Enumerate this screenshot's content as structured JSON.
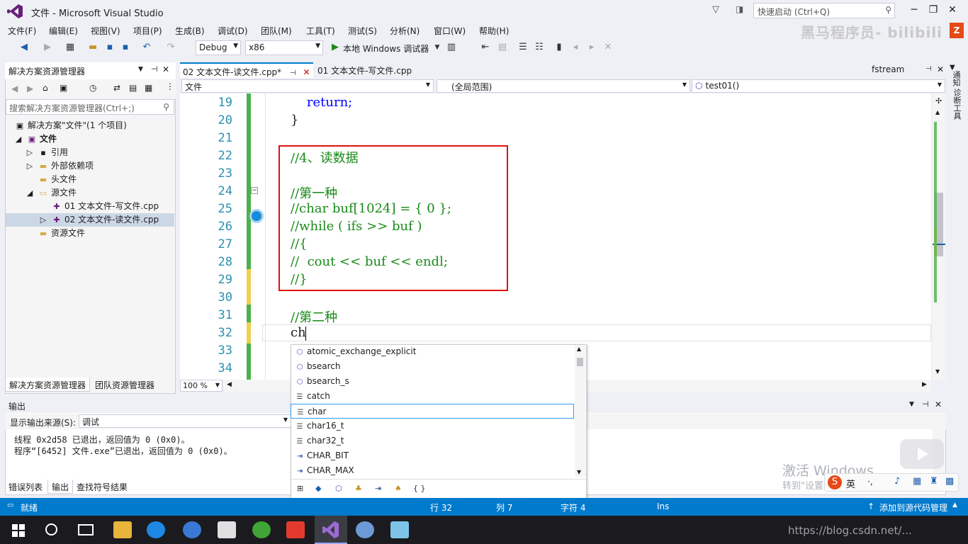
{
  "window": {
    "title": "文件 - Microsoft Visual Studio",
    "quick_launch_placeholder": "快速启动 (Ctrl+Q)",
    "watermark": "黑马程序员- bilibili"
  },
  "menu": [
    "文件(F)",
    "编辑(E)",
    "视图(V)",
    "项目(P)",
    "生成(B)",
    "调试(D)",
    "团队(M)",
    "工具(T)",
    "测试(S)",
    "分析(N)",
    "窗口(W)",
    "帮助(H)"
  ],
  "toolbar": {
    "config": "Debug",
    "platform": "x86",
    "run_label": "本地 Windows 调试器"
  },
  "solution_explorer": {
    "title": "解决方案资源管理器",
    "search_placeholder": "搜索解决方案资源管理器(Ctrl+;)",
    "tree": [
      {
        "label": "解决方案\"文件\"(1 个项目)"
      },
      {
        "label": "文件"
      },
      {
        "label": "引用"
      },
      {
        "label": "外部依赖项"
      },
      {
        "label": "头文件"
      },
      {
        "label": "源文件"
      },
      {
        "label": "01 文本文件-写文件.cpp"
      },
      {
        "label": "02 文本文件-读文件.cpp"
      },
      {
        "label": "资源文件"
      }
    ],
    "tabs": [
      "解决方案资源管理器",
      "团队资源管理器"
    ]
  },
  "editor": {
    "tabs": [
      "02 文本文件-读文件.cpp*",
      "01 文本文件-写文件.cpp"
    ],
    "right_tab": "fstream",
    "nav": {
      "file": "文件",
      "scope": "(全局范围)",
      "func": "test01()"
    },
    "zoom": "100 %",
    "lines": [
      {
        "n": "19",
        "text": "    return;",
        "kind": "kw"
      },
      {
        "n": "20",
        "text": "}",
        "kind": "code"
      },
      {
        "n": "21",
        "text": "",
        "kind": "code"
      },
      {
        "n": "22",
        "text": "//4、读数据",
        "kind": "cm"
      },
      {
        "n": "23",
        "text": "",
        "kind": "code"
      },
      {
        "n": "24",
        "text": "//第一种",
        "kind": "cm"
      },
      {
        "n": "25",
        "text": "//char buf[1024] = { 0 };",
        "kind": "cm"
      },
      {
        "n": "26",
        "text": "//while ( ifs >> buf )",
        "kind": "cm"
      },
      {
        "n": "27",
        "text": "//{",
        "kind": "cm"
      },
      {
        "n": "28",
        "text": "//  cout << buf << endl;",
        "kind": "cm"
      },
      {
        "n": "29",
        "text": "//}",
        "kind": "cm"
      },
      {
        "n": "30",
        "text": "",
        "kind": "code"
      },
      {
        "n": "31",
        "text": "//第二种",
        "kind": "cm"
      },
      {
        "n": "32",
        "text": "ch",
        "kind": "code"
      },
      {
        "n": "33",
        "text": "",
        "kind": "code"
      },
      {
        "n": "34",
        "text": "",
        "kind": "code"
      }
    ]
  },
  "intellisense": {
    "items": [
      {
        "icon": "⬡",
        "label": "atomic_exchange_explicit"
      },
      {
        "icon": "⬡",
        "label": "bsearch"
      },
      {
        "icon": "⬡",
        "label": "bsearch_s"
      },
      {
        "icon": "☰",
        "label": "catch"
      },
      {
        "icon": "☰",
        "label": "char"
      },
      {
        "icon": "☰",
        "label": "char16_t"
      },
      {
        "icon": "☰",
        "label": "char32_t"
      },
      {
        "icon": "⇥",
        "label": "CHAR_BIT"
      },
      {
        "icon": "⇥",
        "label": "CHAR_MAX"
      }
    ],
    "filters": [
      "⊞",
      "◆",
      "⬡",
      "♣",
      "⇥",
      "♠",
      "{ }"
    ]
  },
  "output": {
    "title": "输出",
    "source_label": "显示输出来源(S):",
    "source_value": "调试",
    "lines": [
      "线程 0x2d58 已退出，返回值为 0 (0x0)。",
      "程序“[6452] 文件.exe”已退出，返回值为 0 (0x0)。"
    ],
    "tabs": [
      "错误列表",
      "输出",
      "查找符号结果"
    ]
  },
  "side_tabs": [
    "通知",
    "诊断工具"
  ],
  "status": {
    "ready": "就绪",
    "row": "行 32",
    "col": "列 7",
    "char": "字符 4",
    "ins": "Ins",
    "source_control": "添加到源代码管理"
  },
  "activate": {
    "line1": "激活 Windows",
    "line2": "转到\"设置\"以激活 Windows"
  },
  "taskbar": {
    "tray_text": "https://blog.csdn.net/..."
  }
}
